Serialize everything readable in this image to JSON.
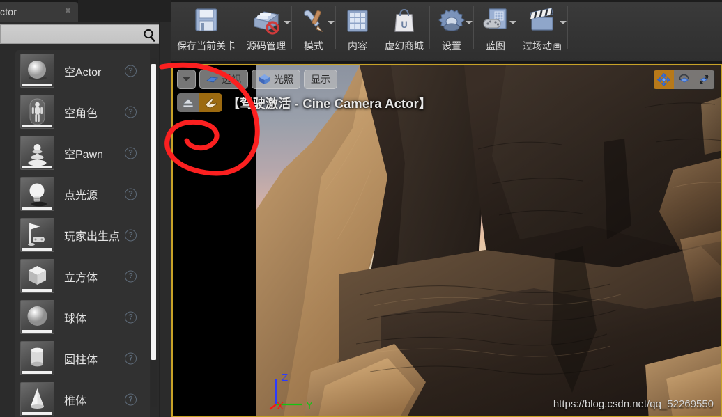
{
  "left_panel": {
    "tab": {
      "label": "ctor",
      "close_icon": "close-icon"
    },
    "search": {
      "value": "",
      "placeholder": "",
      "icon": "search-icon"
    },
    "items": [
      {
        "label": "空Actor",
        "icon": "sphere-actor-icon",
        "help": "?"
      },
      {
        "label": "空角色",
        "icon": "character-capsule-icon",
        "help": "?"
      },
      {
        "label": "空Pawn",
        "icon": "pawn-icon",
        "help": "?"
      },
      {
        "label": "点光源",
        "icon": "point-light-icon",
        "help": "?"
      },
      {
        "label": "玩家出生点",
        "icon": "player-start-icon",
        "help": "?"
      },
      {
        "label": "立方体",
        "icon": "cube-icon",
        "help": "?"
      },
      {
        "label": "球体",
        "icon": "sphere-icon",
        "help": "?"
      },
      {
        "label": "圆柱体",
        "icon": "cylinder-icon",
        "help": "?"
      },
      {
        "label": "椎体",
        "icon": "cone-icon",
        "help": "?"
      }
    ]
  },
  "toolbar": {
    "items": [
      {
        "label": "保存当前关卡",
        "icon": "save-floppy-icon",
        "caret": false
      },
      {
        "label": "源码管理",
        "icon": "source-control-icon",
        "caret": true
      },
      {
        "label": "模式",
        "icon": "modes-wrench-icon",
        "caret": true
      },
      {
        "label": "内容",
        "icon": "content-browser-icon",
        "caret": false
      },
      {
        "label": "虚幻商城",
        "icon": "marketplace-bag-icon",
        "caret": false
      },
      {
        "label": "设置",
        "icon": "settings-gear-icon",
        "caret": true
      },
      {
        "label": "蓝图",
        "icon": "blueprint-icon",
        "caret": true
      },
      {
        "label": "过场动画",
        "icon": "cinematics-clapper-icon",
        "caret": true
      }
    ]
  },
  "viewport": {
    "dropdown_icon": "chevron-down-icon",
    "view_mode": {
      "label": "透视",
      "icon": "perspective-icon"
    },
    "lighting": {
      "label": "光照",
      "icon": "lit-cube-icon"
    },
    "show": {
      "label": "显示"
    },
    "pilot_bar": {
      "eject_icon": "eject-icon",
      "pilot_icon": "pilot-plane-icon",
      "text": "【驾驶激活 - Cine Camera Actor】"
    },
    "transform_tools": [
      {
        "name": "move-tool",
        "icon": "move-gizmo-icon",
        "active": true
      },
      {
        "name": "rotate-tool",
        "icon": "rotate-gizmo-icon",
        "active": false
      },
      {
        "name": "scale-tool",
        "icon": "scale-gizmo-icon",
        "active": false
      }
    ],
    "axis_gizmo": {
      "z": "Z",
      "x": "X",
      "y": "Y"
    },
    "watermark": "https://blog.csdn.net/qq_52269550"
  },
  "colors": {
    "viewport_border": "#c8a227",
    "pilot_active": "#9c6a10",
    "annotation": "#fb2020",
    "axis_z": "#2b3bff",
    "axis_x": "#ff1111",
    "axis_y": "#12c412"
  }
}
